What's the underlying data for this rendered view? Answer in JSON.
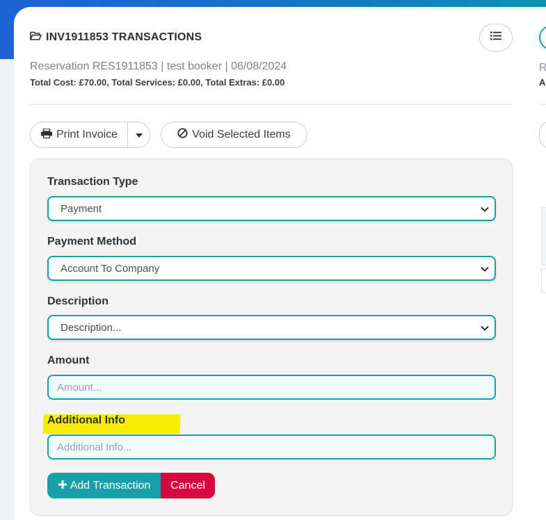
{
  "header": {
    "title": "INV1911853 TRANSACTIONS",
    "subtitle": "Reservation RES1911853 | test booker | 06/08/2024",
    "totals": "Total Cost: £70.00, Total Services: £0.00, Total Extras: £0.00"
  },
  "toolbar": {
    "print_label": "Print Invoice",
    "void_label": "Void Selected Items"
  },
  "form": {
    "transaction_type_label": "Transaction Type",
    "transaction_type_value": "Payment",
    "payment_method_label": "Payment Method",
    "payment_method_value": "Account To Company",
    "description_label": "Description",
    "description_value": "Description...",
    "amount_label": "Amount",
    "amount_placeholder": "Amount...",
    "additional_info_label": "Additional Info",
    "additional_info_placeholder": "Additional Info...",
    "add_button_label": "Add Transaction",
    "cancel_button_label": "Cancel"
  },
  "peek": {
    "r": "R",
    "a": "A"
  },
  "colors": {
    "accent": "#17a0a8",
    "danger": "#d6083f",
    "highlight": "#f7ec00"
  },
  "icons": {
    "title": "folder-open-icon",
    "menu": "list-icon",
    "print": "printer-icon",
    "caret": "caret-down-icon",
    "void": "ban-icon",
    "add": "plus-icon",
    "select": "chevron-down-icon"
  }
}
